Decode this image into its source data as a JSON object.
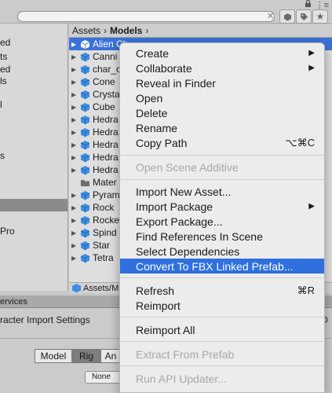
{
  "toolbar": {
    "search_value": ""
  },
  "left_panel": {
    "items": [
      "ed",
      "ts",
      "ed",
      "ls",
      "l",
      "s",
      "Pro"
    ]
  },
  "breadcrumb": {
    "root": "Assets",
    "current": "Models"
  },
  "files": [
    {
      "name": "Alien Ch",
      "selected": true
    },
    {
      "name": "Canni"
    },
    {
      "name": "char_c"
    },
    {
      "name": "Cone"
    },
    {
      "name": "Crysta"
    },
    {
      "name": "Cube"
    },
    {
      "name": "Hedra"
    },
    {
      "name": "Hedra"
    },
    {
      "name": "Hedra"
    },
    {
      "name": "Hedra"
    },
    {
      "name": "Hedra"
    },
    {
      "name": "Mater"
    },
    {
      "name": "Pyram"
    },
    {
      "name": "Rock"
    },
    {
      "name": "Rocke"
    },
    {
      "name": "Spind"
    },
    {
      "name": "Star"
    },
    {
      "name": "Tetra"
    }
  ],
  "pathbar": {
    "text": "Assets/M"
  },
  "services": {
    "label": "ervices"
  },
  "inspector": {
    "title": "racter Import Settings",
    "tabs": [
      "Model",
      "Rig",
      "An"
    ],
    "none_field": "None"
  },
  "context_menu": {
    "create": "Create",
    "collaborate": "Collaborate",
    "reveal": "Reveal in Finder",
    "open": "Open",
    "delete": "Delete",
    "rename": "Rename",
    "copy_path": "Copy Path",
    "copy_path_shortcut": "⌥⌘C",
    "open_scene_additive": "Open Scene Additive",
    "import_new_asset": "Import New Asset...",
    "import_package": "Import Package",
    "export_package": "Export Package...",
    "find_references": "Find References In Scene",
    "select_dependencies": "Select Dependencies",
    "convert_fbx": "Convert To FBX Linked Prefab...",
    "refresh": "Refresh",
    "refresh_shortcut": "⌘R",
    "reimport": "Reimport",
    "reimport_all": "Reimport All",
    "extract_prefab": "Extract From Prefab",
    "run_api_updater": "Run API Updater..."
  },
  "colors": {
    "highlight": "#2f6fe0",
    "selection": "#3a72d8",
    "cube": "#3d8ee0"
  }
}
